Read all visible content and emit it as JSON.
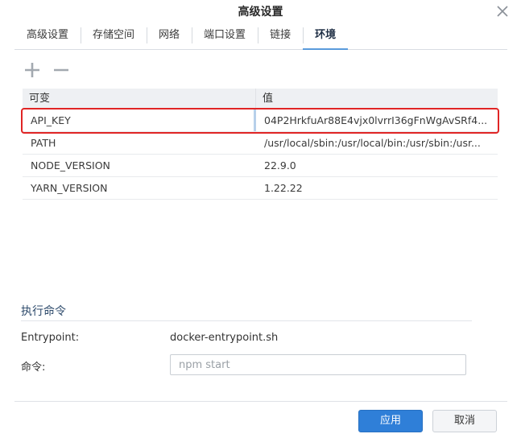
{
  "window": {
    "title": "高级设置"
  },
  "tabs": [
    {
      "label": "高级设置",
      "active": false
    },
    {
      "label": "存储空间",
      "active": false
    },
    {
      "label": "网络",
      "active": false
    },
    {
      "label": "端口设置",
      "active": false
    },
    {
      "label": "链接",
      "active": false
    },
    {
      "label": "环境",
      "active": true
    }
  ],
  "toolbar": {
    "add_icon": "plus-icon",
    "remove_icon": "minus-icon"
  },
  "env_table": {
    "columns": {
      "name": "可变",
      "value": "值"
    },
    "rows": [
      {
        "name": "API_KEY",
        "value": "04P2HrkfuAr88E4vjx0lvrrI36gFnWgAvSRf4...",
        "selected": true
      },
      {
        "name": "PATH",
        "value": "/usr/local/sbin:/usr/local/bin:/usr/sbin:/usr...",
        "selected": false
      },
      {
        "name": "NODE_VERSION",
        "value": "22.9.0",
        "selected": false
      },
      {
        "name": "YARN_VERSION",
        "value": "1.22.22",
        "selected": false
      }
    ]
  },
  "exec": {
    "section_title": "执行命令",
    "entrypoint_label": "Entrypoint:",
    "entrypoint_value": "docker-entrypoint.sh",
    "command_label": "命令:",
    "command_placeholder": "npm start"
  },
  "footer": {
    "apply_label": "应用",
    "cancel_label": "取消"
  },
  "colors": {
    "accent": "#2f7fd8",
    "highlight_border": "#e02525",
    "tab_underline": "#5a9bdc"
  }
}
